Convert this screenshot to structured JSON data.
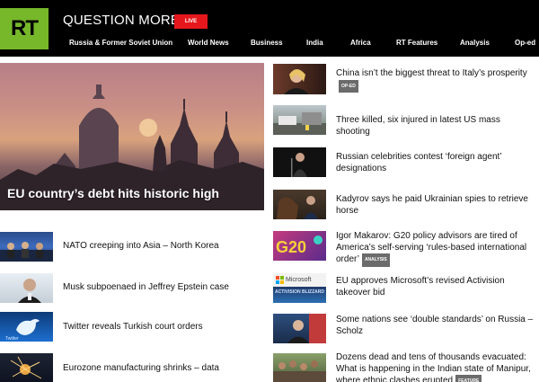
{
  "header": {
    "logo": "RT",
    "tagline": "QUESTION MORE",
    "live_label": "LIVE",
    "nav": [
      "Russia & Former Soviet Union",
      "World News",
      "Business",
      "India",
      "Africa",
      "RT Features",
      "Analysis",
      "Op-ed"
    ]
  },
  "hero": {
    "title": "EU country’s debt hits historic high"
  },
  "left_stories": [
    {
      "title": "NATO creeping into Asia – North Korea",
      "icon": "conference-photo"
    },
    {
      "title": "Musk subpoenaed in Jeffrey Epstein case",
      "icon": "portrait-photo"
    },
    {
      "title": "Twitter reveals Turkish court orders",
      "icon": "twitter-logo-photo"
    },
    {
      "title": "Eurozone manufacturing shrinks – data",
      "icon": "factory-sparks-photo"
    }
  ],
  "right_stories": [
    {
      "title": "China isn’t the biggest threat to Italy’s prosperity",
      "badge": "OP-ED",
      "icon": "politician-photo"
    },
    {
      "title": "Three killed, six injured in latest US mass shooting",
      "badge": "",
      "icon": "street-scene-photo"
    },
    {
      "title": "Russian celebrities contest ‘foreign agent’ designations",
      "badge": "",
      "icon": "performer-photo"
    },
    {
      "title": "Kadyrov says he paid Ukrainian spies to retrieve horse",
      "badge": "",
      "icon": "horse-photo"
    },
    {
      "title": "Igor Makarov: G20 policy advisors are tired of America’s self-serving ‘rules-based international order’",
      "badge": "ANALYSIS",
      "icon": "g20-photo"
    },
    {
      "title": "EU approves Microsoft’s revised Activision takeover bid",
      "badge": "",
      "icon": "microsoft-activision-photo",
      "thumb_text_top": "Microsoft",
      "thumb_text_bottom": "ACTIVISION BLIZZARD"
    },
    {
      "title": "Some nations see ‘double standards’ on Russia – Scholz",
      "badge": "",
      "icon": "scholz-photo"
    },
    {
      "title": "Dozens dead and tens of thousands evacuated: What is happening in the Indian state of Manipur, where ethnic clashes erupted",
      "badge": "FEATURE",
      "icon": "crowd-photo"
    }
  ]
}
